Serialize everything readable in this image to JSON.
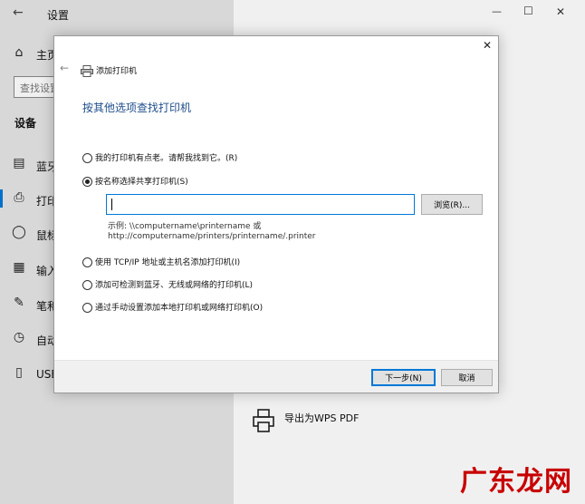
{
  "settings": {
    "title": "设置",
    "home": "主页",
    "search_placeholder": "查找设置",
    "section": "设备",
    "nav": [
      {
        "label": "蓝牙",
        "icon": "bluetooth-icon"
      },
      {
        "label": "打印",
        "icon": "printer-icon"
      },
      {
        "label": "鼠标",
        "icon": "mouse-icon"
      },
      {
        "label": "输入",
        "icon": "keyboard-icon"
      },
      {
        "label": "笔和",
        "icon": "pen-icon"
      },
      {
        "label": "自动",
        "icon": "autoplay-icon"
      },
      {
        "label": "USB",
        "icon": "usb-icon"
      }
    ],
    "window_controls": {
      "minimize": "—",
      "maximize": "☐",
      "close": "✕"
    },
    "printer_entry": "导出为WPS PDF"
  },
  "dialog": {
    "title": "添加打印机",
    "heading": "按其他选项查找打印机",
    "options": [
      {
        "label": "我的打印机有点老。请帮我找到它。(R)",
        "selected": false
      },
      {
        "label": "按名称选择共享打印机(S)",
        "selected": true
      },
      {
        "label": "使用 TCP/IP 地址或主机名添加打印机(I)",
        "selected": false
      },
      {
        "label": "添加可检测到蓝牙、无线或网络的打印机(L)",
        "selected": false
      },
      {
        "label": "通过手动设置添加本地打印机或网络打印机(O)",
        "selected": false
      }
    ],
    "share_input_value": "",
    "browse_label": "浏览(R)...",
    "example_line1": "示例: \\\\computername\\printername 或",
    "example_line2": "http://computername/printers/printername/.printer",
    "next_label": "下一步(N)",
    "cancel_label": "取消",
    "close_glyph": "✕",
    "back_glyph": "←"
  },
  "watermark": "广东龙网",
  "colors": {
    "heading": "#1f4e8c",
    "accent": "#0078d7",
    "watermark": "#c80000"
  }
}
